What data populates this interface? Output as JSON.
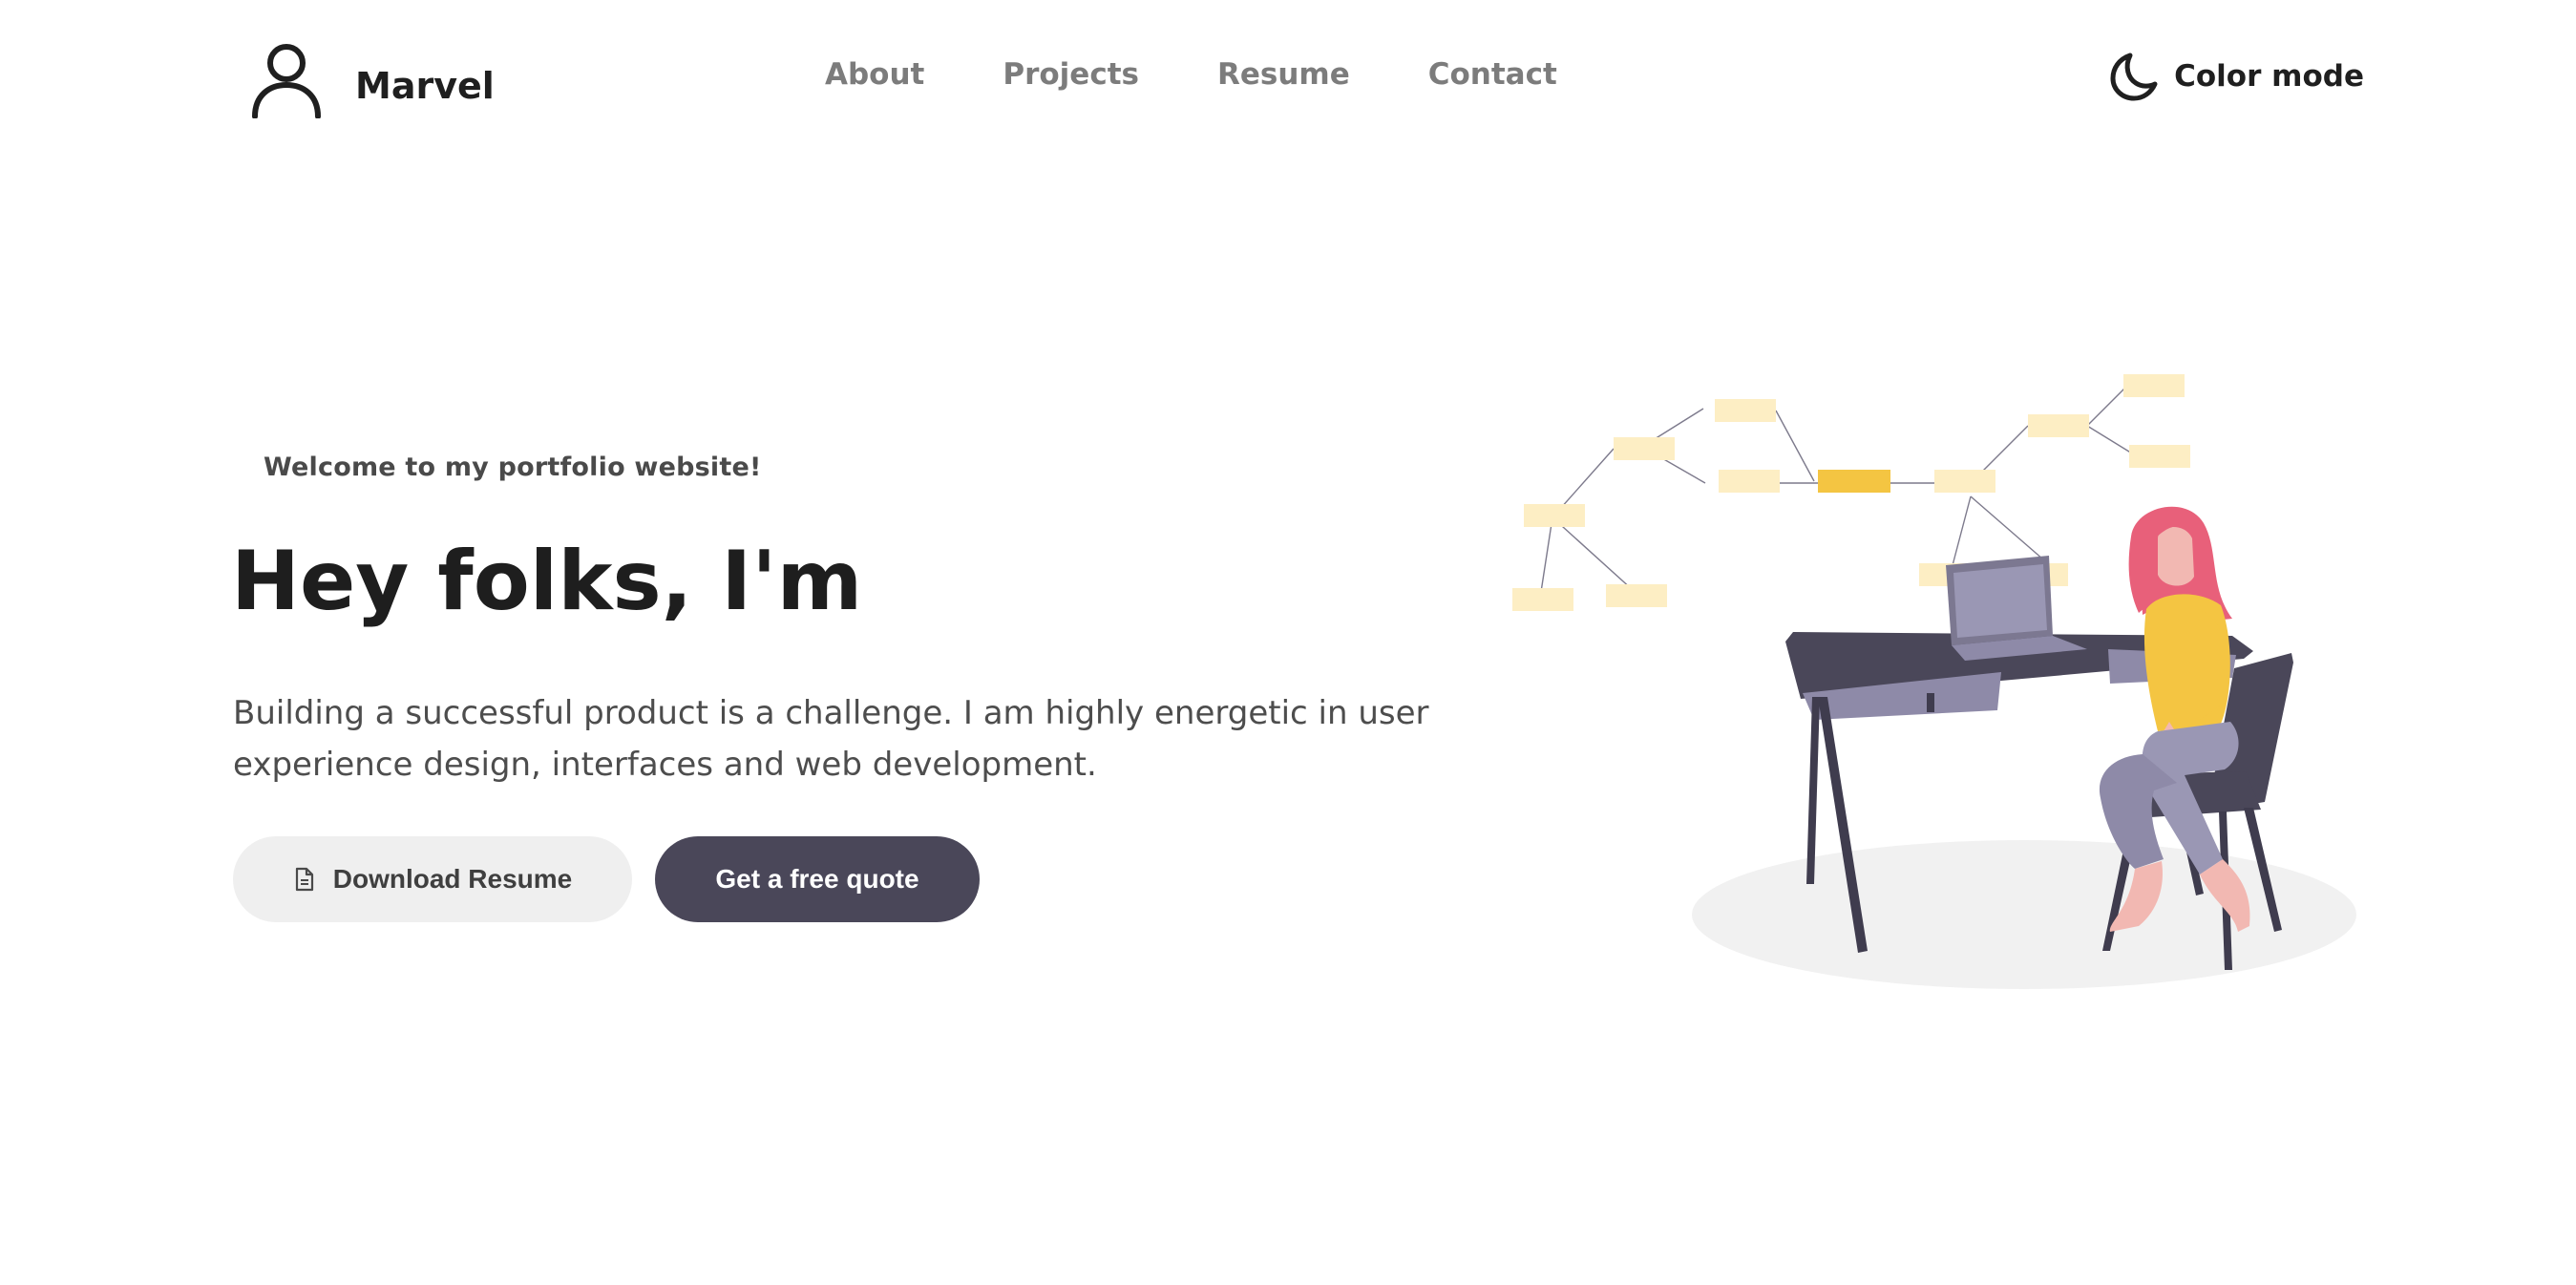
{
  "header": {
    "brand_name": "Marvel",
    "nav": {
      "about": "About",
      "projects": "Projects",
      "resume": "Resume",
      "contact": "Contact"
    },
    "color_mode_label": "Color mode",
    "icons": {
      "brand": "user-icon",
      "color_mode": "moon-icon"
    }
  },
  "hero": {
    "welcome": "Welcome to my portfolio website!",
    "headline": "Hey folks, I'm",
    "description": "Building a successful product is a challenge. I am highly energetic in user experience design, interfaces and web development.",
    "buttons": {
      "download_resume": "Download Resume",
      "free_quote": "Get a free quote"
    },
    "illustration": "person-at-desk-with-laptop-and-mind-map"
  },
  "colors": {
    "text_dark": "#1e1e1e",
    "nav_text": "#7c7c7c",
    "primary_button": "#4a4759",
    "secondary_button": "#efefef",
    "accent_yellow": "#f4c542",
    "note_yellow": "#fdeec4"
  }
}
